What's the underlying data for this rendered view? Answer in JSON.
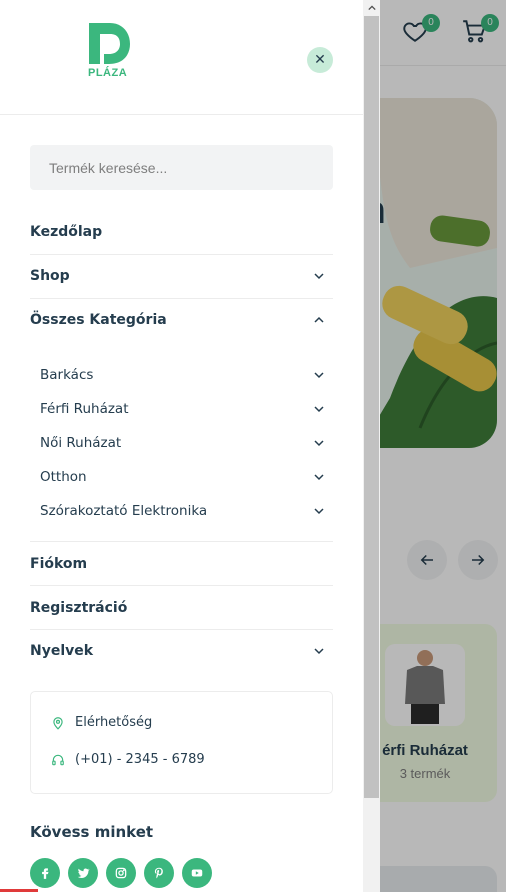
{
  "background": {
    "wishlist_count": "0",
    "cart_count": "0",
    "hero_text": "m",
    "category_card": {
      "name": "érfi Ruházat",
      "count": "3 termék"
    }
  },
  "panel": {
    "logo_text": "PLÁZA",
    "search": {
      "placeholder": "Termék keresése..."
    },
    "menu": {
      "home": "Kezdőlap",
      "shop": "Shop",
      "all_categories": "Összes Kategória",
      "categories": [
        "Barkács",
        "Férfi Ruházat",
        "Női Ruházat",
        "Otthon",
        "Szórakoztató Elektronika"
      ],
      "account": "Fiókom",
      "register": "Regisztráció",
      "languages": "Nyelvek"
    },
    "contact": {
      "location_label": "Elérhetőség",
      "phone": "(+01) - 2345 - 6789"
    },
    "follow_title": "Kövess minket",
    "socials": [
      "facebook-icon",
      "twitter-icon",
      "instagram-icon",
      "pinterest-icon",
      "youtube-icon"
    ]
  },
  "colors": {
    "accent": "#3bb77e",
    "text": "#253d4e",
    "muted": "#7e7e7e"
  }
}
